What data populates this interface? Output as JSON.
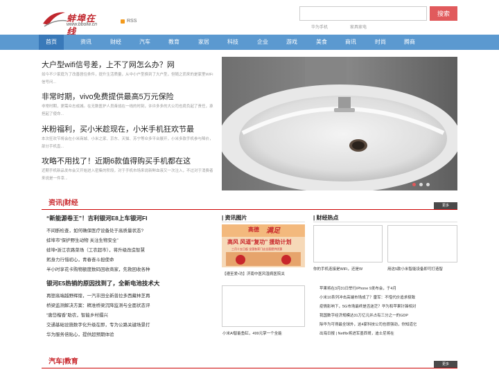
{
  "header": {
    "logo_text": "蚌埠在线",
    "logo_url": "www.bbolw.cn",
    "rss": "RSS",
    "search_button": "搜索",
    "hot_links": [
      "华为手机",
      "家具家电"
    ]
  },
  "nav": [
    "首页",
    "资讯",
    "财经",
    "汽车",
    "教育",
    "家居",
    "科技",
    "企业",
    "游戏",
    "美食",
    "商讯",
    "时尚",
    "腾商"
  ],
  "hero": [
    {
      "title": "大户型wifi信号差，上不了网怎么办？网",
      "desc": "如今不少家庭为了改善居住条件，提升生活质量，从中小户型换到了大户型，但随之而来的是家里WiFi信号问..."
    },
    {
      "title": "非常时期，vivo免费提供最高5万元保险",
      "desc": "非常时期，更需众志成城。在无数医护人员奋战在一线的时刻，许许多多的大公司也肩负起了责任，承担起了使命..."
    },
    {
      "title": "米粉福利，买小米趁现在，小米手机狂欢节最",
      "desc": "本次狂欢节将会在小米商城、小米之家、京东、天猫、苏宁等众多平台展开，小米多款手机参与降价，部分手机直..."
    },
    {
      "title": "攻略不用找了！近期6款值得购买手机都在这",
      "desc": "近期手机新品发布会又开始进入密集的阶段，对于手机市场来说新鲜血液又一次注入，不过对于消费者来说是一件幸..."
    }
  ],
  "section1": {
    "title": "资讯|财经",
    "more": "更多",
    "col_pic": "| 资讯图片",
    "col_hot": "| 财经热点",
    "headline1": "“新能源卷王”！吉利银河E8上车银河FI",
    "list1": [
      "不间断检查，如何确保医疗设备处于高质量状态?",
      "蚌埠市“保护野生动物 关注生物安全”",
      "蚌埠•浙江农路菜场（工农超市），将升级改造智慧",
      "躬身力行惜初心，青春奋斗担使命",
      "半小时享花卡购物额度数码回收商家，先救回收各种"
    ],
    "headline2": "银河E5热销的原因找到了，全新电池技术大",
    "list2": [
      "再塑高端越野辉煌，一汽丰田全新普拉多西藏林芝再",
      "桥梁监测解决方案：精准桥梁沉降监测与全面状态评",
      "“唐岱榴香”助农，智能乡村擂兴",
      "交通基础设施数字化升级在即，专为公路关键场景打",
      "华为服务倍贴心，提供超预期体验"
    ],
    "pics": [
      {
        "caption": "【遵至爱•功】济南中医风湿病医院关"
      },
      {
        "caption": "小米Al智能鱼缸，499元掌一个全能"
      }
    ],
    "hot_thumbs": [
      {
        "caption": "你的手机连接是WiFi，还是W"
      },
      {
        "caption": "用这5款小米智能设备即可打造智"
      }
    ],
    "hot_list": [
      "苹果将在3月31日举行iPhone 9发布会，于4月",
      "小米10系列冲击高端市场成了？雷军：不惜代价追求极致",
      "疫情影响下，5G市场最终是否迷茫？华为和苹果针锋相对",
      "我国数字经济规模达31万亿元并占有三分之一的GDP",
      "除华为可得最全球外，这4家科技公司也很强劲，你知道它",
      "出海日报 | Netflix将进军墨西哥，迪士尼将在"
    ],
    "banner": {
      "line1": "高德",
      "line2": "满足",
      "line3": "高风 风道“复功” 援助计划",
      "line4": "三月十五日起 全国各家门店全面提供优惠"
    }
  },
  "section2": {
    "title": "汽车|教育",
    "more": "更多"
  },
  "colors": {
    "accent": "#c8262b",
    "nav": "#5b99d0",
    "nav_active": "#3979b9",
    "search": "#e15a5c"
  }
}
